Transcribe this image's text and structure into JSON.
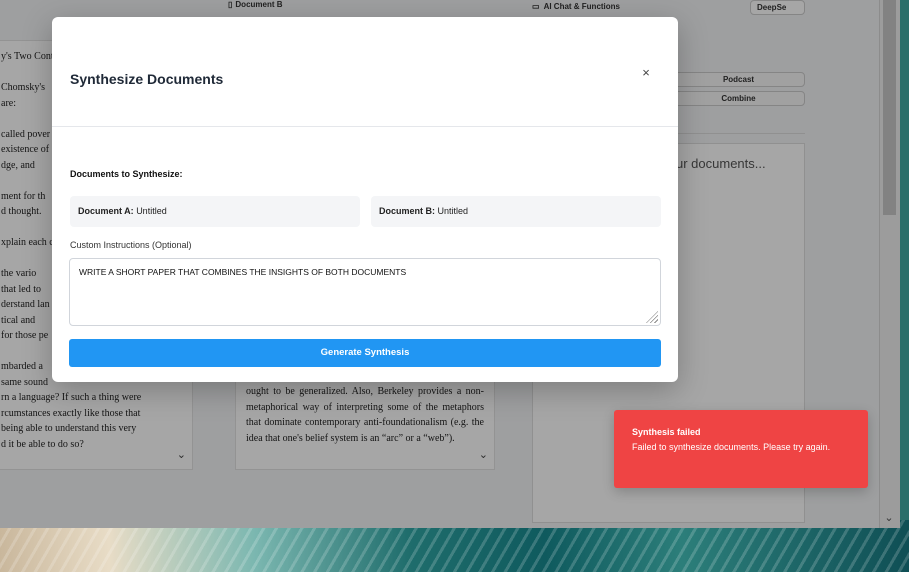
{
  "background_app": {
    "doc_b_header": "Document B",
    "chat_header": "AI Chat & Functions",
    "model_selector": "DeepSe",
    "buttons": [
      "Podcast",
      "Combine"
    ],
    "chat_placeholder": "ur documents...",
    "doc_a_text": "y's Two Cont\n\nChomsky's\nare:\n\ncalled pover\nexistence of\ndge, and\n\nment for th\nd thought.\n\nxplain each c\n\n the vario\n that led to\nderstand lan\ntical and\nfor those pe\n\nmbarded a\nsame sound\nrn a language? If such a thing were\nrcumstances exactly like those that\n being able to understand this very\nd it be able to do so?",
    "doc_b_text": "ought to be generalized. Also, Berkeley provides a non-metaphorical way of interpreting some of the metaphors that dominate contemporary anti-foundationalism (e.g. the idea that one's belief system is an “arc” or a “web”)."
  },
  "modal": {
    "title": "Synthesize Documents",
    "close_symbol": "×",
    "section_label": "Documents to Synthesize:",
    "doc_a": {
      "label": "Document A:",
      "value": "Untitled"
    },
    "doc_b": {
      "label": "Document B:",
      "value": "Untitled"
    },
    "instructions_label": "Custom Instructions (Optional)",
    "instructions_value": "WRITE A SHORT PAPER THAT COMBINES THE INSIGHTS OF BOTH DOCUMENTS",
    "generate_label": "Generate Synthesis"
  },
  "toast": {
    "title": "Synthesis failed",
    "message": "Failed to synthesize documents. Please try again.",
    "color": "#ef4444"
  },
  "colors": {
    "accent": "#2196f3"
  }
}
